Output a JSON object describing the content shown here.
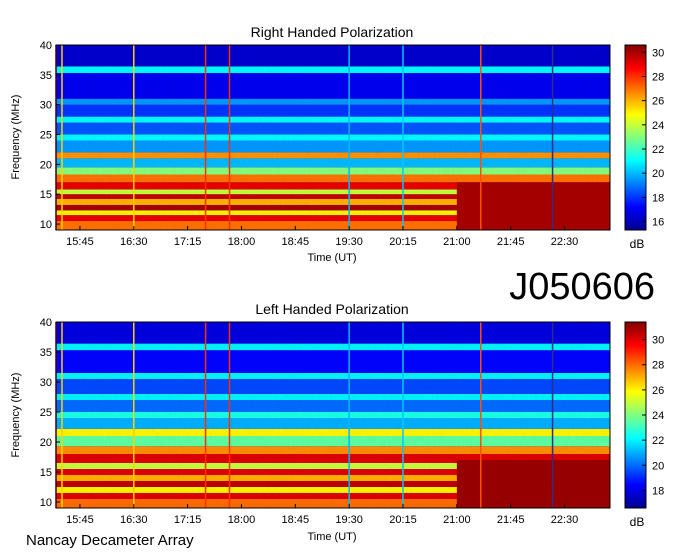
{
  "observation_id": "J050606",
  "instrument": "Nancay Decameter Array",
  "chart_data": [
    {
      "type": "heatmap",
      "title": "Right Handed Polarization",
      "xlabel": "Time (UT)",
      "ylabel": "Frequency (MHz)",
      "x_ticks": [
        "15:45",
        "16:30",
        "17:15",
        "18:00",
        "18:45",
        "19:30",
        "20:15",
        "21:00",
        "21:45",
        "22:30"
      ],
      "x_range": [
        "15:25",
        "23:08"
      ],
      "y_ticks": [
        10,
        15,
        20,
        25,
        30,
        35,
        40
      ],
      "ylim": [
        9,
        40
      ],
      "colorbar": {
        "label": "dB",
        "ticks": [
          16,
          18,
          20,
          22,
          24,
          26,
          28,
          30
        ],
        "range": [
          15.3,
          30.6
        ]
      },
      "colormap": "jet",
      "bands": [
        {
          "f": [
            9,
            10.5
          ],
          "db": 27
        },
        {
          "f": [
            10.5,
            11.5
          ],
          "db": 29
        },
        {
          "f": [
            11.5,
            12.3
          ],
          "db": 25
        },
        {
          "f": [
            12.3,
            13.2
          ],
          "db": 30
        },
        {
          "f": [
            13.2,
            14.2
          ],
          "db": 26
        },
        {
          "f": [
            14.2,
            15
          ],
          "db": 29.5
        },
        {
          "f": [
            15,
            15.8
          ],
          "db": 24
        },
        {
          "f": [
            15.8,
            17
          ],
          "db": 29
        },
        {
          "f": [
            17,
            18.3
          ],
          "db": 27
        },
        {
          "f": [
            18.3,
            19.5
          ],
          "db": 23
        },
        {
          "f": [
            19.5,
            21
          ],
          "db": 20
        },
        {
          "f": [
            21,
            22
          ],
          "db": 26.5
        },
        {
          "f": [
            22,
            24
          ],
          "db": 19.5
        },
        {
          "f": [
            24,
            25
          ],
          "db": 21
        },
        {
          "f": [
            25,
            27
          ],
          "db": 18.5
        },
        {
          "f": [
            27,
            28
          ],
          "db": 21
        },
        {
          "f": [
            28,
            30
          ],
          "db": 18
        },
        {
          "f": [
            30,
            31
          ],
          "db": 19.5
        },
        {
          "f": [
            31,
            35.3
          ],
          "db": 17
        },
        {
          "f": [
            35.3,
            36.4
          ],
          "db": 21
        },
        {
          "f": [
            36.4,
            40
          ],
          "db": 16.5
        }
      ],
      "late_enhancement": {
        "t": [
          "21:00",
          "23:08"
        ],
        "f": [
          9,
          17
        ],
        "db": 30
      },
      "vertical_lines": [
        {
          "t": "15:25",
          "color": "#d40000"
        },
        {
          "t": "15:30",
          "color": "#ffd000"
        },
        {
          "t": "16:30",
          "color": "#ffd000"
        },
        {
          "t": "17:30",
          "color": "#ff3000"
        },
        {
          "t": "17:50",
          "color": "#ff3000"
        },
        {
          "t": "19:30",
          "color": "#00b8ff"
        },
        {
          "t": "20:15",
          "color": "#00c8ff"
        },
        {
          "t": "21:20",
          "color": "#ff5000"
        },
        {
          "t": "22:20",
          "color": "#2d2d8a"
        }
      ]
    },
    {
      "type": "heatmap",
      "title": "Left Handed Polarization",
      "xlabel": "Time (UT)",
      "ylabel": "Frequency (MHz)",
      "x_ticks": [
        "15:45",
        "16:30",
        "17:15",
        "18:00",
        "18:45",
        "19:30",
        "20:15",
        "21:00",
        "21:45",
        "22:30"
      ],
      "x_range": [
        "15:25",
        "23:08"
      ],
      "y_ticks": [
        10,
        15,
        20,
        25,
        30,
        35,
        40
      ],
      "ylim": [
        9,
        40
      ],
      "colorbar": {
        "label": "dB",
        "ticks": [
          18,
          20,
          22,
          24,
          26,
          28,
          30
        ],
        "range": [
          16.6,
          31.4
        ]
      },
      "colormap": "jet",
      "bands": [
        {
          "f": [
            9,
            10.5
          ],
          "db": 28
        },
        {
          "f": [
            10.5,
            11.5
          ],
          "db": 30
        },
        {
          "f": [
            11.5,
            12.5
          ],
          "db": 26
        },
        {
          "f": [
            12.5,
            13.5
          ],
          "db": 30.5
        },
        {
          "f": [
            13.5,
            14.5
          ],
          "db": 27
        },
        {
          "f": [
            14.5,
            15.5
          ],
          "db": 30
        },
        {
          "f": [
            15.5,
            16.5
          ],
          "db": 25
        },
        {
          "f": [
            16.5,
            18
          ],
          "db": 30
        },
        {
          "f": [
            18,
            19.3
          ],
          "db": 27.5
        },
        {
          "f": [
            19.3,
            21
          ],
          "db": 23.5
        },
        {
          "f": [
            21,
            22.2
          ],
          "db": 26
        },
        {
          "f": [
            22.2,
            24
          ],
          "db": 21
        },
        {
          "f": [
            24,
            25
          ],
          "db": 22.5
        },
        {
          "f": [
            25,
            27
          ],
          "db": 20
        },
        {
          "f": [
            27,
            28
          ],
          "db": 22
        },
        {
          "f": [
            28,
            30.5
          ],
          "db": 19.5
        },
        {
          "f": [
            30.5,
            31.5
          ],
          "db": 22
        },
        {
          "f": [
            31.5,
            35.3
          ],
          "db": 18.5
        },
        {
          "f": [
            35.3,
            36.4
          ],
          "db": 22
        },
        {
          "f": [
            36.4,
            40
          ],
          "db": 18
        }
      ],
      "late_enhancement": {
        "t": [
          "21:00",
          "23:08"
        ],
        "f": [
          9,
          17
        ],
        "db": 31
      },
      "vertical_lines": [
        {
          "t": "15:25",
          "color": "#d40000"
        },
        {
          "t": "15:30",
          "color": "#ffd000"
        },
        {
          "t": "16:30",
          "color": "#ffd000"
        },
        {
          "t": "17:30",
          "color": "#ff3000"
        },
        {
          "t": "17:50",
          "color": "#ff3000"
        },
        {
          "t": "19:30",
          "color": "#00b8ff"
        },
        {
          "t": "20:15",
          "color": "#00c8ff"
        },
        {
          "t": "21:20",
          "color": "#ff5000"
        },
        {
          "t": "22:20",
          "color": "#2d2d8a"
        }
      ]
    }
  ]
}
